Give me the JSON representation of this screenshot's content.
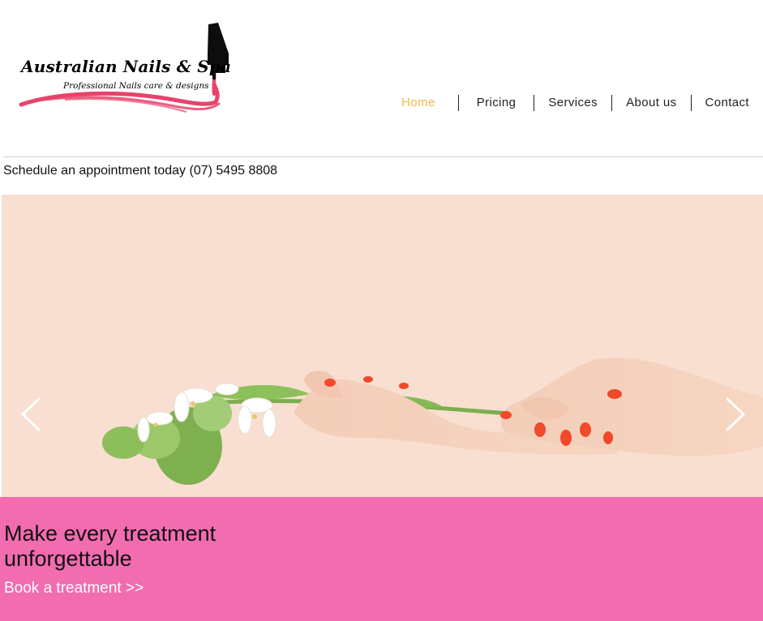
{
  "brand": {
    "name": "Australian Nails & Spa",
    "tagline": "Professional Nails care & designs"
  },
  "nav": {
    "items": [
      {
        "label": "Home",
        "active": true
      },
      {
        "label": "Pricing",
        "active": false
      },
      {
        "label": "Services",
        "active": false
      },
      {
        "label": "About us",
        "active": false
      },
      {
        "label": "Contact",
        "active": false
      }
    ]
  },
  "appointment": {
    "text": "Schedule an appointment today (07) 5495 8808"
  },
  "hero": {
    "image": "hands-with-red-nails-holding-flowers",
    "prev_icon": "chevron-left-icon",
    "next_icon": "chevron-right-icon"
  },
  "banner": {
    "headline": "Make every treatment unforgettable",
    "cta": "Book a treatment >>"
  },
  "colors": {
    "accent": "#f0b84b",
    "banner": "#f26cb0",
    "hero_bg": "#f8dfd1",
    "logo_pink": "#e8436b",
    "nail_red": "#f04a2a"
  }
}
